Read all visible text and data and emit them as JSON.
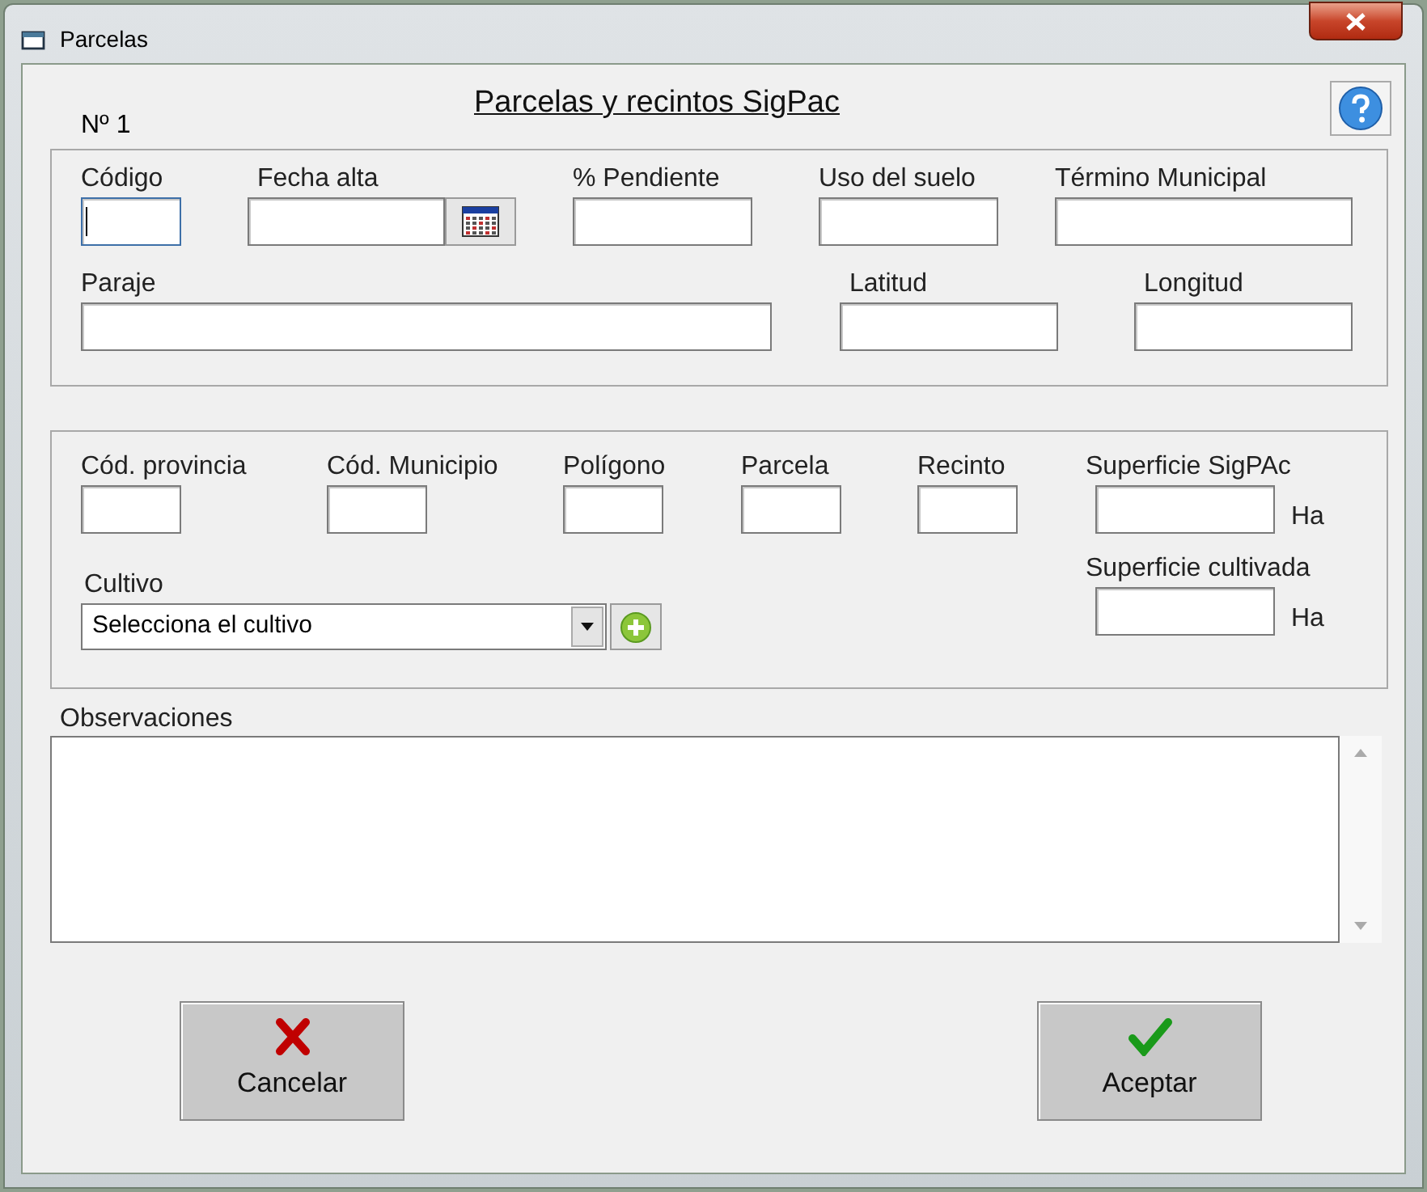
{
  "window": {
    "title": "Parcelas"
  },
  "record_number": "Nº 1",
  "heading": "Parcelas y recintos SigPac",
  "location": {
    "row_1": [
      {
        "label": "Código",
        "focused": true
      },
      {
        "label": "Fecha alta",
        "focused": false,
        "kind": "date"
      },
      {
        "label": "% Pendiente",
        "focused": false
      },
      {
        "label": "Uso del suelo",
        "focused": false
      },
      {
        "label": "Término Municipal",
        "focused": false
      }
    ],
    "row_2": [
      {
        "label": "Paraje"
      },
      {
        "label": "Latitud"
      },
      {
        "label": "Longitud"
      }
    ]
  },
  "sigpac": {
    "row_1": [
      {
        "label": "Cód. provincia"
      },
      {
        "label": "Cód. Municipio"
      },
      {
        "label": "Polígono"
      },
      {
        "label": "Parcela"
      },
      {
        "label": "Recinto"
      },
      {
        "label": "Superficie SigPAc",
        "unit": "Ha"
      }
    ],
    "crop": {
      "label": "Cultivo",
      "value": "Selecciona el cultivo"
    },
    "cultivated_area": {
      "label": "Superficie cultivada",
      "unit": "Ha"
    }
  },
  "observations": {
    "label": "Observaciones"
  },
  "buttons": [
    {
      "label": "Cancelar",
      "kind": "cancel"
    },
    {
      "label": "Aceptar",
      "kind": "accept"
    }
  ]
}
